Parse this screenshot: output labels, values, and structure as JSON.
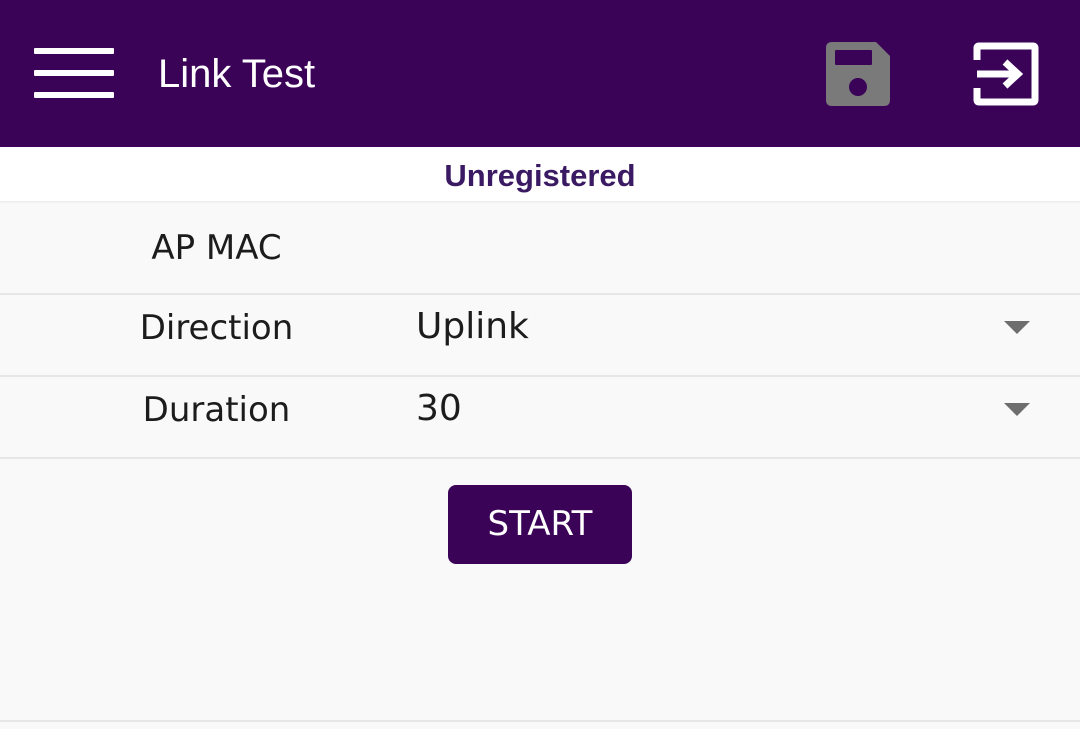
{
  "app_bar": {
    "title": "Link Test",
    "background_color": "#3a0358",
    "menu_icon": "hamburger-menu-icon",
    "save_icon": "floppy-disk-icon",
    "exit_icon": "sign-in-arrow-icon",
    "save_icon_state": "disabled"
  },
  "status": {
    "text": "Unregistered",
    "color": "#3a1a62"
  },
  "form": {
    "ap_mac": {
      "label": "AP MAC",
      "value": ""
    },
    "direction": {
      "label": "Direction",
      "value": "Uplink"
    },
    "duration": {
      "label": "Duration",
      "value": "30"
    }
  },
  "start_button": {
    "label": "START",
    "color": "#3a0358"
  }
}
